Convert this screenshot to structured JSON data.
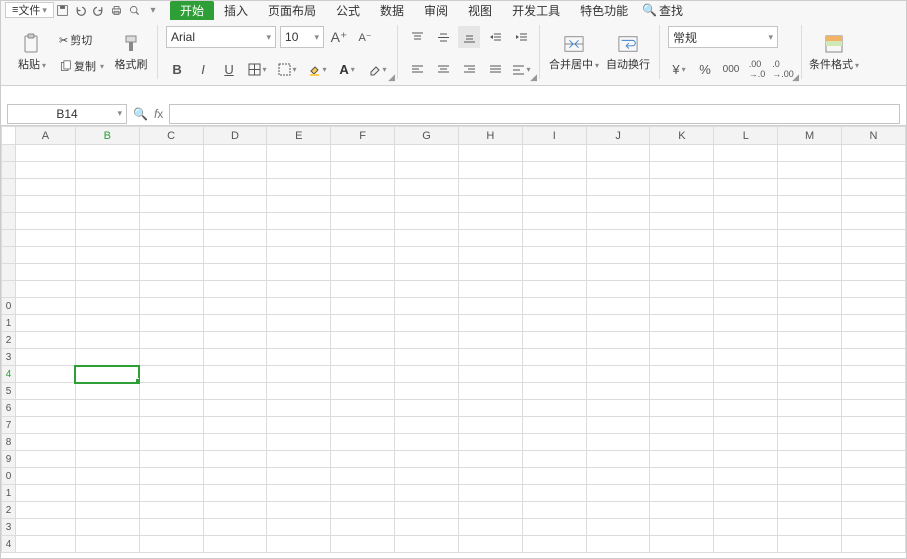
{
  "menubar": {
    "file": "文件",
    "tabs": [
      "开始",
      "插入",
      "页面布局",
      "公式",
      "数据",
      "审阅",
      "视图",
      "开发工具",
      "特色功能"
    ],
    "active_tab": 0,
    "search": "查找"
  },
  "ribbon": {
    "clipboard": {
      "cut": "剪切",
      "copy": "复制",
      "paste": "粘贴",
      "format_painter": "格式刷"
    },
    "font": {
      "name": "Arial",
      "size": "10"
    },
    "merge": {
      "merge_center": "合并居中",
      "wrap": "自动换行"
    },
    "number": {
      "format": "常规"
    },
    "cond_format": "条件格式"
  },
  "namebox": {
    "ref": "B14"
  },
  "formula": {
    "value": ""
  },
  "grid": {
    "cols": [
      "A",
      "B",
      "C",
      "D",
      "E",
      "F",
      "G",
      "H",
      "I",
      "J",
      "K",
      "L",
      "M",
      "N"
    ],
    "rows": [
      "",
      "",
      "",
      "",
      "",
      "",
      "",
      "",
      "",
      "0",
      "1",
      "2",
      "3",
      "4",
      "5",
      "6",
      "7",
      "8",
      "9",
      "0",
      "1",
      "2",
      "3",
      "4"
    ],
    "selected": {
      "col": "B",
      "row_index": 13
    }
  }
}
